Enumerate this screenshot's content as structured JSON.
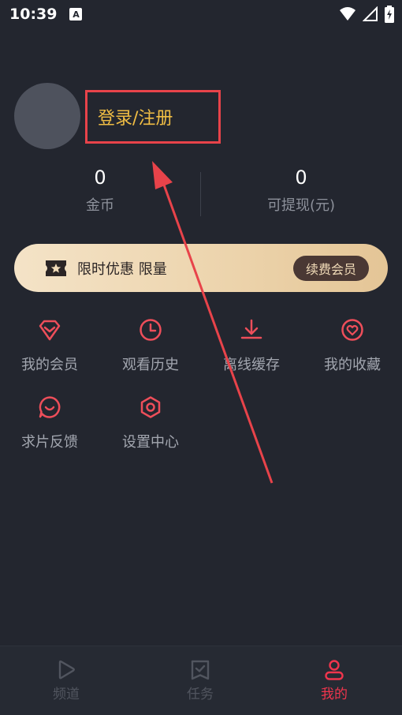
{
  "status_bar": {
    "time": "10:39",
    "notification_icon": "A"
  },
  "profile": {
    "login_label": "登录/注册"
  },
  "stats": [
    {
      "value": "0",
      "label": "金币"
    },
    {
      "value": "0",
      "label": "可提现(元)"
    }
  ],
  "vip_banner": {
    "text": "限时优惠 限量",
    "button_label": "续费会员"
  },
  "menu": [
    {
      "label": "我的会员",
      "icon": "diamond-icon"
    },
    {
      "label": "观看历史",
      "icon": "clock-icon"
    },
    {
      "label": "离线缓存",
      "icon": "download-icon"
    },
    {
      "label": "我的收藏",
      "icon": "heart-icon"
    },
    {
      "label": "求片反馈",
      "icon": "feedback-icon"
    },
    {
      "label": "设置中心",
      "icon": "settings-icon"
    }
  ],
  "tabbar": [
    {
      "label": "频道",
      "icon": "play-icon",
      "active": false
    },
    {
      "label": "任务",
      "icon": "task-icon",
      "active": false
    },
    {
      "label": "我的",
      "icon": "user-icon",
      "active": true
    }
  ],
  "colors": {
    "accent": "#f0354d",
    "login_text": "#f0bd44",
    "highlight_box": "#e8434a",
    "background": "#23262f"
  }
}
